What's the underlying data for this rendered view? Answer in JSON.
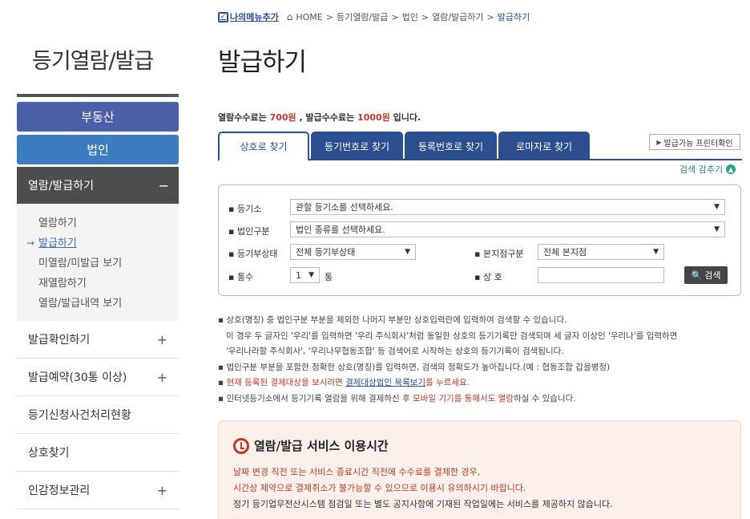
{
  "sidebar": {
    "title": "등기열람/발급",
    "top_buttons": [
      "부동산",
      "법인"
    ],
    "active_menu": "열람/발급하기",
    "active_sign": "−",
    "sub_items": [
      "열람하기",
      "발급하기",
      "미열람/미발급 보기",
      "재열람하기",
      "열람/발급내역 보기"
    ],
    "current_sub_arrow": "→",
    "menu_items": [
      {
        "label": "발급확인하기",
        "sign": "+"
      },
      {
        "label": "발급예약(30통 이상)",
        "sign": "+"
      },
      {
        "label": "등기신청사건처리현황",
        "sign": ""
      },
      {
        "label": "상호찾기",
        "sign": ""
      },
      {
        "label": "인감정보관리",
        "sign": "+"
      }
    ]
  },
  "breadcrumb": {
    "mymenu": "나의메뉴추가",
    "home": "HOME",
    "items": [
      "등기열람/발급",
      "법인",
      "열람/발급하기",
      "발급하기"
    ],
    "sep": ">"
  },
  "page_title": "발급하기",
  "fee": {
    "p1": "열람수수료는 ",
    "v1": "700원",
    "p2": " , 발급수수료는 ",
    "v2": "1000원",
    "p3": " 입니다."
  },
  "tabs": [
    "상호로 찾기",
    "등기번호로 찾기",
    "등록번호로 찾기",
    "로마자로 찾기"
  ],
  "printer_btn": "발급가능 프린터확인",
  "hide_search": "검색 감추기",
  "form": {
    "registry_label": "▪ 등기소",
    "registry_value": "관할 등기소를 선택하세요.",
    "corp_type_label": "▪ 법인구분",
    "corp_type_value": "법인 종류를 선택하세요.",
    "status_label": "▪ 등기부상태",
    "status_value": "전체 등기부상태",
    "branch_label": "▪ 본지점구분",
    "branch_value": "전체 본지점",
    "copies_label": "▪ 통수",
    "copies_value": "1",
    "copies_unit": "통",
    "name_label": "▪ 상 호",
    "name_value": "",
    "search_button": "검색"
  },
  "notes": {
    "n1": "▪ 상호(명칭) 중 법인구분 부분을 제외한 나머지 부분만 상호입력란에 입력하여 검색할 수 있습니다.",
    "n2": "이 경우 두 글자인 '우리'를 입력하면 '우리 주식회사'처럼 동일한 상호의 등기기록만 검색되며 세 글자 이상인 '우리나'를 입력하면",
    "n3": "'우리나라할 주식회사', '우리나무협동조합' 등 검색어로 시작하는 상호의 등기기록이 검색됩니다.",
    "n4": "▪ 법인구분 부분을 포함한 정확한 상호(명칭)를 입력하면, 검색의 정확도가 높아집니다.(예 : 협동조합 갑을병정)",
    "n5a": "▪ ",
    "n5b": "현재 등록된 결제대상을 보시려면 ",
    "n5c": "결제대상법인 목록보기",
    "n5d": "를 누르세요.",
    "n6a": "▪ 인터넷등기소에서 등기기록 열람을 위해 결제하신 후 ",
    "n6b": "모바일 기기를 통해서도 열람",
    "n6c": "하실 수 있습니다."
  },
  "service": {
    "title": "열람/발급 서비스 이용시간",
    "line1": "날짜 변경 직전 또는 서비스 종료시간 직전에 수수료를 결제한 경우,",
    "line2": "시간상 제약으로 결제취소가 불가능할 수 있으므로 이용시 유의하시기 바랍니다.",
    "line3": "정기 등기업무전산시스템 점검일 또는 별도 공지사항에 기재된 작업일에는 서비스를 제공하지 않습니다."
  },
  "colors": {
    "accent_blue": "#2b4f8f",
    "purple_btn": "#4a5fa8",
    "blue_btn": "#3d7cbf",
    "red_text": "#c0392b"
  }
}
